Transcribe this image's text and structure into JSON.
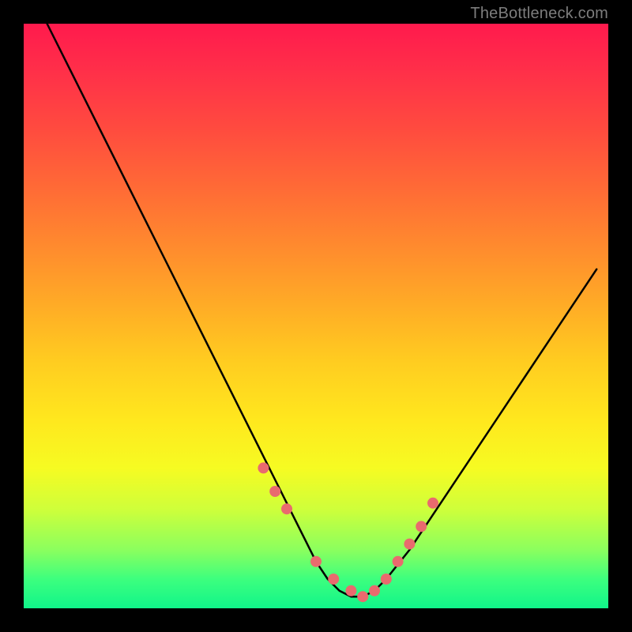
{
  "watermark": "TheBottleneck.com",
  "chart_data": {
    "type": "line",
    "title": "",
    "xlabel": "",
    "ylabel": "",
    "xlim": [
      0,
      100
    ],
    "ylim": [
      0,
      100
    ],
    "grid": false,
    "legend": false,
    "series": [
      {
        "name": "bottleneck-curve",
        "color": "#000000",
        "x": [
          4,
          8,
          12,
          16,
          20,
          24,
          28,
          32,
          36,
          40,
          44,
          48,
          50,
          52,
          54,
          56,
          58,
          60,
          62,
          66,
          70,
          74,
          78,
          82,
          86,
          90,
          94,
          98
        ],
        "y": [
          100,
          92,
          84,
          76,
          68,
          60,
          52,
          44,
          36,
          28,
          20,
          12,
          8,
          5,
          3,
          2,
          2,
          3,
          5,
          10,
          16,
          22,
          28,
          34,
          40,
          46,
          52,
          58
        ]
      }
    ],
    "markers": {
      "name": "highlight-points",
      "color": "#e96a6e",
      "radius_px": 7,
      "x": [
        41,
        43,
        45,
        50,
        53,
        56,
        58,
        60,
        62,
        64,
        66,
        68,
        70
      ],
      "y": [
        24,
        20,
        17,
        8,
        5,
        3,
        2,
        3,
        5,
        8,
        11,
        14,
        18
      ]
    }
  },
  "colors": {
    "background": "#000000",
    "watermark": "#7d7d7d",
    "curve": "#000000",
    "marker_fill": "#e96a6e"
  }
}
